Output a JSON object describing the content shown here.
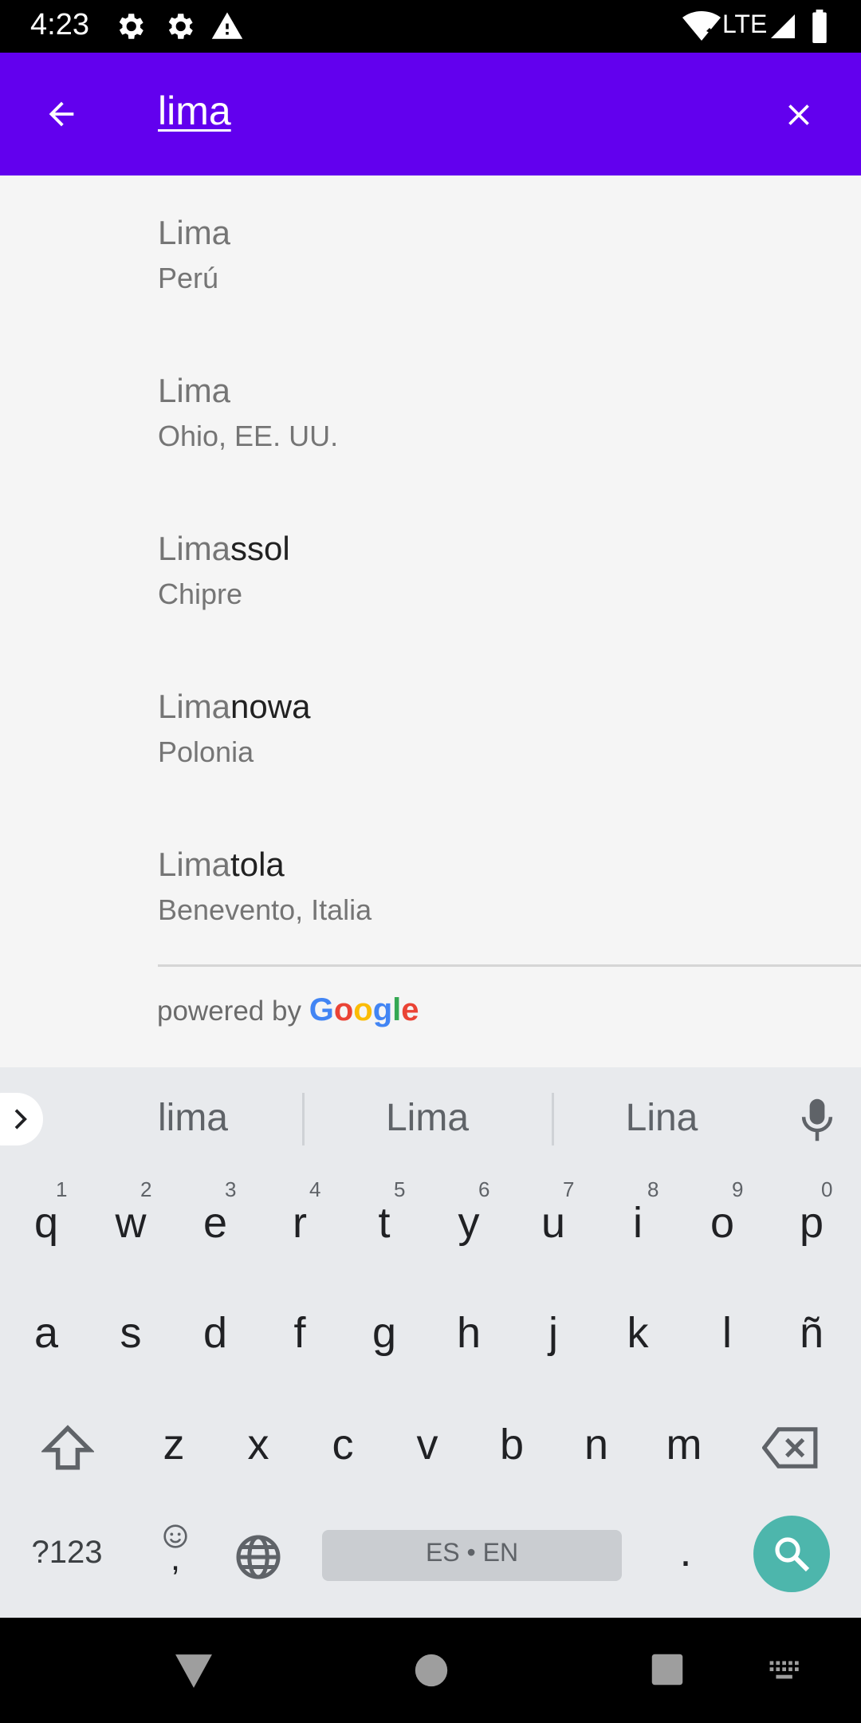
{
  "status_bar": {
    "time": "4:23",
    "network": "LTE",
    "icons": [
      "gear-icon",
      "gear-icon",
      "warning-icon",
      "wifi-icon",
      "signal-icon",
      "battery-icon"
    ]
  },
  "app_bar": {
    "back_icon": "arrow-back-icon",
    "query": "lima",
    "clear_icon": "close-icon",
    "background": "#6200ee"
  },
  "results": [
    {
      "match": "Lima",
      "rest": "",
      "subtitle": "Perú"
    },
    {
      "match": "Lima",
      "rest": "",
      "subtitle": "Ohio, EE. UU."
    },
    {
      "match": "Lima",
      "rest": "ssol",
      "subtitle": "Chipre"
    },
    {
      "match": "Lima",
      "rest": "nowa",
      "subtitle": "Polonia"
    },
    {
      "match": "Lima",
      "rest": "tola",
      "subtitle": "Benevento, Italia"
    }
  ],
  "attribution": {
    "prefix": "powered by",
    "google": [
      "G",
      "o",
      "o",
      "g",
      "l",
      "e"
    ],
    "google_colors": [
      "#4285F4",
      "#EA4335",
      "#FBBC05",
      "#4285F4",
      "#34A853",
      "#EA4335"
    ]
  },
  "keyboard": {
    "suggestions": [
      "lima",
      "Lima",
      "Lina"
    ],
    "row1": [
      {
        "k": "q",
        "n": "1"
      },
      {
        "k": "w",
        "n": "2"
      },
      {
        "k": "e",
        "n": "3"
      },
      {
        "k": "r",
        "n": "4"
      },
      {
        "k": "t",
        "n": "5"
      },
      {
        "k": "y",
        "n": "6"
      },
      {
        "k": "u",
        "n": "7"
      },
      {
        "k": "i",
        "n": "8"
      },
      {
        "k": "o",
        "n": "9"
      },
      {
        "k": "p",
        "n": "0"
      }
    ],
    "row2": [
      "a",
      "s",
      "d",
      "f",
      "g",
      "h",
      "j",
      "k",
      "l",
      "ñ"
    ],
    "row3": [
      "z",
      "x",
      "c",
      "v",
      "b",
      "n",
      "m"
    ],
    "symbols_key": "?123",
    "comma_key": ",",
    "period_key": ".",
    "space_label": "ES • EN",
    "accent": "#4db6ac"
  }
}
